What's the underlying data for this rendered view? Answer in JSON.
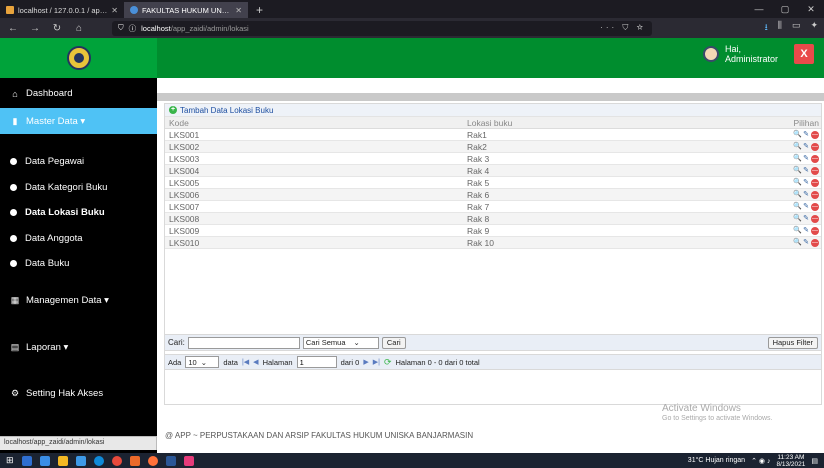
{
  "browser": {
    "tabs": [
      {
        "label": "localhost / 127.0.0.1 / app_zaidi",
        "active": false
      },
      {
        "label": "FAKULTAS HUKUM UNISKA BAN",
        "active": true
      }
    ],
    "new_tab": "+",
    "url_host": "localhost",
    "url_path": "/app_zaidi/admin/lokasi",
    "url_actions": "··· ⛉ ☆",
    "status_url": "localhost/app_zaidi/admin/lokasi"
  },
  "header": {
    "greeting_line1": "Hai,",
    "greeting_line2": "Administrator",
    "logout_label": "X"
  },
  "sidebar": {
    "dashboard": "Dashboard",
    "master_data": "Master Data ▾",
    "items": [
      "Data Pegawai",
      "Data Kategori Buku",
      "Data Lokasi Buku",
      "Data Anggota",
      "Data Buku"
    ],
    "managemen": "Managemen Data ▾",
    "laporan": "Laporan ▾",
    "setting": "Setting Hak Akses"
  },
  "grid": {
    "add_label": "Tambah Data Lokasi Buku",
    "columns": [
      "Kode",
      "Lokasi buku",
      "Pilihan"
    ],
    "rows": [
      [
        "LKS001",
        "Rak1"
      ],
      [
        "LKS002",
        "Rak2"
      ],
      [
        "LKS003",
        "Rak 3"
      ],
      [
        "LKS004",
        "Rak 4"
      ],
      [
        "LKS005",
        "Rak 5"
      ],
      [
        "LKS006",
        "Rak 6"
      ],
      [
        "LKS007",
        "Rak 7"
      ],
      [
        "LKS008",
        "Rak 8"
      ],
      [
        "LKS009",
        "Rak 9"
      ],
      [
        "LKS010",
        "Rak 10"
      ]
    ]
  },
  "filter": {
    "cari_label": "Cari:",
    "search_value": "",
    "select_value": "Cari Semua",
    "cari_button": "Cari",
    "hapus_filter": "Hapus Filter"
  },
  "pager": {
    "ada": "Ada",
    "per_page": "10",
    "data_label": "data",
    "halaman_label": "Halaman",
    "page_value": "1",
    "dari_label": "dari 0",
    "summary": "Halaman 0 - 0 dari 0 total"
  },
  "footer": "@ APP ~ PERPUSTAKAAN DAN ARSIP FAKULTAS HUKUM UNISKA BANJARMASIN",
  "watermark": {
    "line1": "Activate Windows",
    "line2": "Go to Settings to activate Windows."
  },
  "taskbar": {
    "weather": "31°C  Hujan ringan",
    "time": "11:23 AM",
    "date": "8/13/2021"
  },
  "colors": {
    "header_green": "#008d2e",
    "active_blue": "#4fc2f5",
    "logout_red": "#e94a4a"
  }
}
